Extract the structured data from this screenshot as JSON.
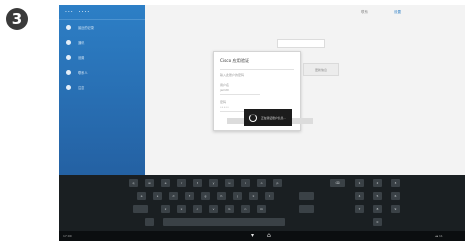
{
  "step_badge": "3",
  "sidebar": {
    "header": [
      "• • •",
      "• • • •"
    ],
    "items": [
      {
        "icon": "clock-icon",
        "label": "最近的记录"
      },
      {
        "icon": "grid-icon",
        "label": "通讯"
      },
      {
        "icon": "gear-icon",
        "label": "设置"
      },
      {
        "icon": "person-icon",
        "label": "联系人"
      },
      {
        "icon": "info-icon",
        "label": "注意"
      }
    ]
  },
  "topbar": {
    "tab_left": "联系",
    "tab_right": "设置"
  },
  "dialog": {
    "title": "Cisco 应用验证",
    "prompt": "输入此账户的密码",
    "field1_label": "用户名",
    "field1_value": "jsmith",
    "field2_label": "密码",
    "field2_value": "•••••"
  },
  "side_button": "更新信息",
  "toast": {
    "text": "正在验证账户信息..."
  },
  "keyboard": {
    "row1": [
      "q",
      "w",
      "e",
      "r",
      "t",
      "y",
      "u",
      "i",
      "o",
      "p"
    ],
    "row2": [
      "a",
      "s",
      "d",
      "f",
      "g",
      "h",
      "j",
      "k",
      "l"
    ],
    "row3": [
      "z",
      "x",
      "c",
      "v",
      "b",
      "n",
      "m"
    ],
    "backspace": "⌫",
    "numpad": [
      "1",
      "2",
      "3",
      "4",
      "5",
      "6",
      "7",
      "8",
      "9",
      "0"
    ]
  },
  "navbar": {
    "back": "▾",
    "home": "⌂",
    "left_text": "17:00",
    "right_text": "◂◂  11"
  }
}
